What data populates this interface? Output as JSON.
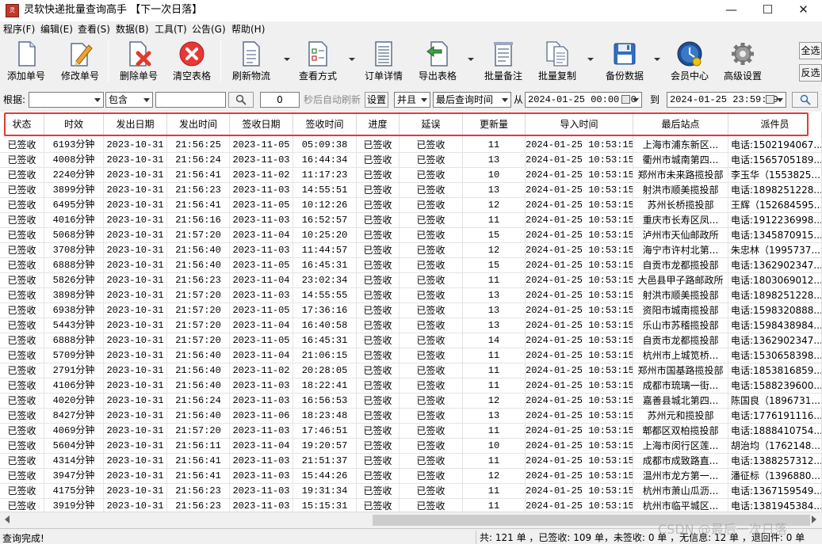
{
  "window": {
    "title": "灵软快递批量查询高手 【下一次日落】",
    "icon": "app-icon",
    "controls": [
      "minimize-icon",
      "maximize-icon",
      "close-icon"
    ]
  },
  "menu": [
    "程序(F)",
    "编辑(E)",
    "查看(S)",
    "数据(B)",
    "工具(T)",
    "公告(G)",
    "帮助(H)"
  ],
  "toolbar": {
    "add": "添加单号",
    "edit": "修改单号",
    "delete": "删除单号",
    "clear": "清空表格",
    "refresh": "刷新物流",
    "view_mode": "查看方式",
    "order_detail": "订单详情",
    "export": "导出表格",
    "batch_note": "批量备注",
    "batch_copy": "批量复制",
    "backup": "备份数据",
    "member": "会员中心",
    "settings": "高级设置",
    "select_all": "全选",
    "invert": "反选"
  },
  "filter": {
    "based_on_label": "根据:",
    "based_on_value": "",
    "match_mode": "包含",
    "keyword": "",
    "seconds": "0",
    "auto_refresh_label": "秒后自动刷新",
    "settings_button": "设置",
    "logic": "并且",
    "time_field": "最后查询时间",
    "from_label": "从",
    "from_time": "2024-01-25 00:00:00",
    "to_label": "到",
    "to_time": "2024-01-25 23:59:59"
  },
  "table": {
    "columns": [
      "状态",
      "时效",
      "发出日期",
      "发出时间",
      "签收日期",
      "签收时间",
      "进度",
      "延误",
      "更新量",
      "导入时间",
      "最后站点",
      "派件员"
    ],
    "rows": [
      [
        "已签收",
        "6193分钟",
        "2023-10-31",
        "21:56:25",
        "2023-11-05",
        "05:09:38",
        "已签收",
        "已签收",
        "11",
        "2024-01-25  10:53:15",
        "上海市浦东新区...",
        "电话:1502194067..."
      ],
      [
        "已签收",
        "4008分钟",
        "2023-10-31",
        "21:56:24",
        "2023-11-03",
        "16:44:34",
        "已签收",
        "已签收",
        "13",
        "2024-01-25  10:53:15",
        "衢州市城南第四...",
        "电话:1565705189..."
      ],
      [
        "已签收",
        "2240分钟",
        "2023-10-31",
        "21:56:41",
        "2023-11-02",
        "11:17:23",
        "已签收",
        "已签收",
        "10",
        "2024-01-25  10:53:15",
        "郑州市未来路揽投部",
        "李玉华（1553825..."
      ],
      [
        "已签收",
        "3899分钟",
        "2023-10-31",
        "21:56:23",
        "2023-11-03",
        "14:55:51",
        "已签收",
        "已签收",
        "13",
        "2024-01-25  10:53:15",
        "射洪市顺美揽投部",
        "电话:1898251228..."
      ],
      [
        "已签收",
        "6495分钟",
        "2023-10-31",
        "21:56:41",
        "2023-11-05",
        "10:12:26",
        "已签收",
        "已签收",
        "12",
        "2024-01-25  10:53:15",
        "苏州长桥揽投部",
        "王辉（152684595..."
      ],
      [
        "已签收",
        "4016分钟",
        "2023-10-31",
        "21:56:16",
        "2023-11-03",
        "16:52:57",
        "已签收",
        "已签收",
        "11",
        "2024-01-25  10:53:15",
        "重庆市长寿区凤...",
        "电话:1912236998..."
      ],
      [
        "已签收",
        "5068分钟",
        "2023-10-31",
        "21:57:20",
        "2023-11-04",
        "10:25:20",
        "已签收",
        "已签收",
        "15",
        "2024-01-25  10:53:15",
        "泸州市天仙邮政所",
        "电话:1345870915..."
      ],
      [
        "已签收",
        "3708分钟",
        "2023-10-31",
        "21:56:40",
        "2023-11-03",
        "11:44:57",
        "已签收",
        "已签收",
        "12",
        "2024-01-25  10:53:15",
        "海宁市许村北第...",
        "朱忠林（1995737..."
      ],
      [
        "已签收",
        "6888分钟",
        "2023-10-31",
        "21:56:40",
        "2023-11-05",
        "16:45:31",
        "已签收",
        "已签收",
        "15",
        "2024-01-25  10:53:15",
        "自贡市龙都揽投部",
        "电话:1362902347..."
      ],
      [
        "已签收",
        "5826分钟",
        "2023-10-31",
        "21:56:23",
        "2023-11-04",
        "23:02:34",
        "已签收",
        "已签收",
        "11",
        "2024-01-25  10:53:15",
        "大邑县甲子路邮政所",
        "电话:1803069012..."
      ],
      [
        "已签收",
        "3898分钟",
        "2023-10-31",
        "21:57:20",
        "2023-11-03",
        "14:55:55",
        "已签收",
        "已签收",
        "13",
        "2024-01-25  10:53:15",
        "射洪市顺美揽投部",
        "电话:1898251228..."
      ],
      [
        "已签收",
        "6938分钟",
        "2023-10-31",
        "21:57:20",
        "2023-11-05",
        "17:36:16",
        "已签收",
        "已签收",
        "13",
        "2024-01-25  10:53:15",
        "资阳市城南揽投部",
        "电话:1598320888..."
      ],
      [
        "已签收",
        "5443分钟",
        "2023-10-31",
        "21:57:20",
        "2023-11-04",
        "16:40:58",
        "已签收",
        "已签收",
        "13",
        "2024-01-25  10:53:15",
        "乐山市苏稽揽投部",
        "电话:1598438984..."
      ],
      [
        "已签收",
        "6888分钟",
        "2023-10-31",
        "21:57:20",
        "2023-11-05",
        "16:45:31",
        "已签收",
        "已签收",
        "14",
        "2024-01-25  10:53:15",
        "自贡市龙都揽投部",
        "电话:1362902347..."
      ],
      [
        "已签收",
        "5709分钟",
        "2023-10-31",
        "21:56:40",
        "2023-11-04",
        "21:06:15",
        "已签收",
        "已签收",
        "11",
        "2024-01-25  10:53:15",
        "杭州市上城笕桥...",
        "电话:1530658398..."
      ],
      [
        "已签收",
        "2791分钟",
        "2023-10-31",
        "21:56:40",
        "2023-11-02",
        "20:28:05",
        "已签收",
        "已签收",
        "11",
        "2024-01-25  10:53:15",
        "郑州市国基路揽投部",
        "电话:1853816859..."
      ],
      [
        "已签收",
        "4106分钟",
        "2023-10-31",
        "21:56:40",
        "2023-11-03",
        "18:22:41",
        "已签收",
        "已签收",
        "11",
        "2024-01-25  10:53:15",
        "成都市琉璃一街...",
        "电话:1588239600..."
      ],
      [
        "已签收",
        "4020分钟",
        "2023-10-31",
        "21:56:24",
        "2023-11-03",
        "16:56:53",
        "已签收",
        "已签收",
        "12",
        "2024-01-25  10:53:15",
        "嘉善县城北第四...",
        "陈国良（1896731..."
      ],
      [
        "已签收",
        "8427分钟",
        "2023-10-31",
        "21:56:40",
        "2023-11-06",
        "18:23:48",
        "已签收",
        "已签收",
        "13",
        "2024-01-25  10:53:15",
        "苏州元和揽投部",
        "电话:1776191116..."
      ],
      [
        "已签收",
        "4069分钟",
        "2023-10-31",
        "21:57:20",
        "2023-11-03",
        "17:46:51",
        "已签收",
        "已签收",
        "11",
        "2024-01-25  10:53:15",
        "郫都区双柏揽投部",
        "电话:1888410754..."
      ],
      [
        "已签收",
        "5604分钟",
        "2023-10-31",
        "21:56:11",
        "2023-11-04",
        "19:20:57",
        "已签收",
        "已签收",
        "10",
        "2024-01-25  10:53:15",
        "上海市闵行区莲...",
        "胡治均（1762148..."
      ],
      [
        "已签收",
        "4314分钟",
        "2023-10-31",
        "21:56:41",
        "2023-11-03",
        "21:51:37",
        "已签收",
        "已签收",
        "11",
        "2024-01-25  10:53:15",
        "成都市成致路直...",
        "电话:1388257312..."
      ],
      [
        "已签收",
        "3947分钟",
        "2023-10-31",
        "21:56:41",
        "2023-11-03",
        "15:44:26",
        "已签收",
        "已签收",
        "12",
        "2024-01-25  10:53:15",
        "温州市龙方第一...",
        "潘征标（1396880..."
      ],
      [
        "已签收",
        "4175分钟",
        "2023-10-31",
        "21:56:23",
        "2023-11-03",
        "19:31:34",
        "已签收",
        "已签收",
        "11",
        "2024-01-25  10:53:15",
        "杭州市萧山瓜沥...",
        "电话:1367159549..."
      ],
      [
        "已签收",
        "3919分钟",
        "2023-10-31",
        "21:56:23",
        "2023-11-03",
        "15:15:31",
        "已签收",
        "已签收",
        "11",
        "2024-01-25  10:53:15",
        "杭州市临平城区...",
        "电话:1381945384..."
      ]
    ]
  },
  "status": {
    "left": "查询完成!",
    "right": "共: 121 单 ，已签收: 109 单，未签收: 0 单 ，无信息: 12 单 ，退回件: 0 单"
  },
  "watermark": "CSDN @最后一次日落",
  "colors": {
    "highlight_box": "#e53935",
    "delete_red": "#e03b2e",
    "grid_line": "#e4e4e4"
  }
}
